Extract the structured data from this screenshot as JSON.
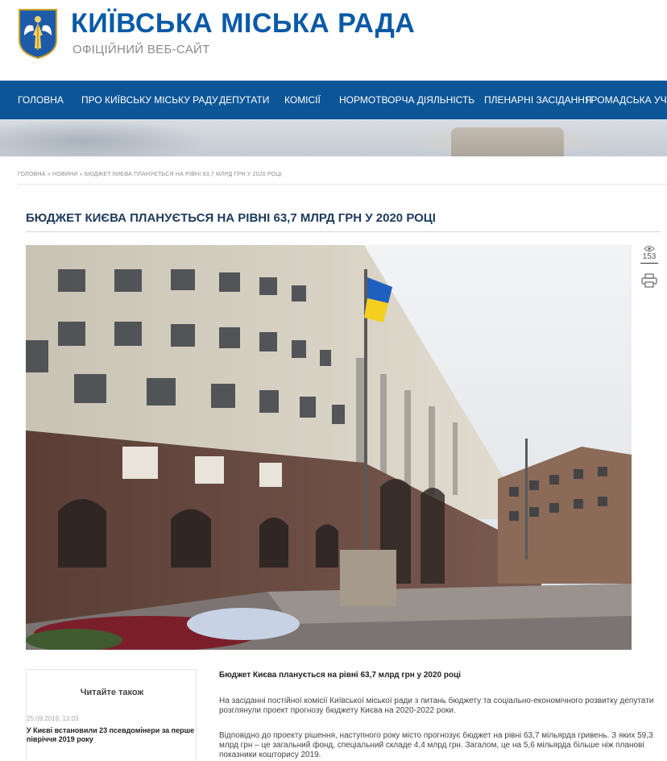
{
  "header": {
    "title": "КИЇВСЬКА МІСЬКА РАДА",
    "subtitle": "ОФІЦІЙНИЙ ВЕБ-САЙТ",
    "logo_icon": "kyiv-coat-of-arms-icon"
  },
  "nav": {
    "items": [
      {
        "label": "ГОЛОВНА"
      },
      {
        "label": "ПРО КИЇВСЬКУ МІСЬКУ РАДУ"
      },
      {
        "label": "ДЕПУТАТИ"
      },
      {
        "label": "КОМІСІЇ"
      },
      {
        "label": "НОРМОТВОРЧА ДІЯЛЬНІСТЬ"
      },
      {
        "label": "ПЛЕНАРНІ ЗАСІДАННЯ"
      },
      {
        "label": "ГРОМАДСЬКА УЧАСТ"
      }
    ]
  },
  "breadcrumb": "ГОЛОВНА » НОВИНИ » БЮДЖЕТ КИЄВА ПЛАНУЄТЬСЯ НА РІВНІ 63,7 МЛРД ГРН У 2020 РОЦІ",
  "article": {
    "title": "БЮДЖЕТ КИЄВА ПЛАНУЄТЬСЯ НА РІВНІ 63,7 МЛРД ГРН У 2020 РОЦІ",
    "views": "153",
    "body_head": "Бюджет Києва планується на рівні 63,7 млрд грн у 2020 році",
    "p1": "На засіданні постійної комісії Київської міської ради з питань бюджету та соціально-економічного розвитку депутати розглянули проект прогнозу бюджету Києва на 2020-2022 роки.",
    "p2": "Відповідно до проекту рішення, наступного року місто прогнозує бюджет на рівні 63,7 мільярда гривень. З яких 59,3 млрд грн – це загальний фонд, спеціальний складе 4,4 млрд грн. Загалом, це на 5,6 мільярда більше ніж планові показники кошторису 2019."
  },
  "read_also": {
    "title": "Читайте також",
    "date": "25.09.2019, 13:03",
    "link": "У Києві встановили 23 псевдомінери за перше півріччя 2019 року"
  },
  "colors": {
    "brand_blue": "#0b5aa6",
    "nav_blue": "#0c5596"
  }
}
